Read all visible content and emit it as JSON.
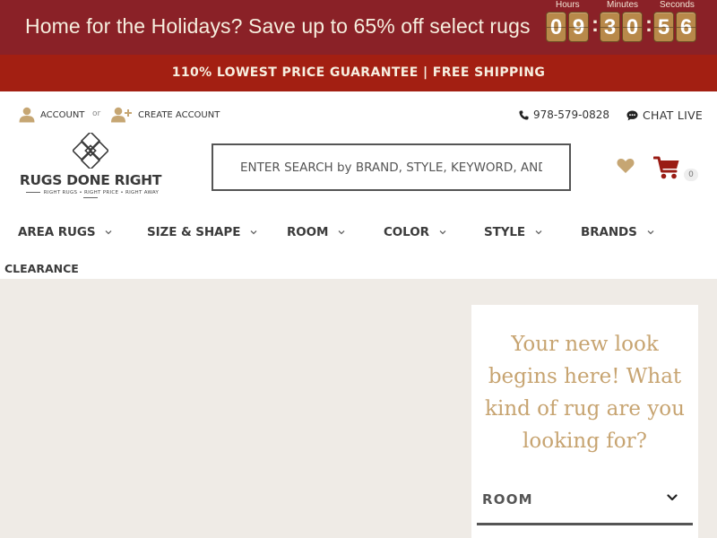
{
  "promo": {
    "text": "Home for the Holidays? Save up to 65% off select rugs",
    "countdown": {
      "hours_label": "Hours",
      "minutes_label": "Minutes",
      "seconds_label": "Seconds",
      "h1": "0",
      "h2": "9",
      "m1": "3",
      "m2": "0",
      "s1": "5",
      "s2": "6"
    }
  },
  "guarantee": {
    "text": "110% LOWEST PRICE GUARANTEE | FREE SHIPPING"
  },
  "account": {
    "account_label": "ACCOUNT",
    "or_label": "or",
    "create_label": "CREATE ACCOUNT"
  },
  "contact": {
    "phone": "978-579-0828",
    "chat": "CHAT LIVE"
  },
  "logo": {
    "name": "RUGS DONE RIGHT",
    "tagline": "RIGHT RUGS • RIGHT PRICE • RIGHT AWAY"
  },
  "search": {
    "placeholder": "ENTER SEARCH by BRAND, STYLE, KEYWORD, AND"
  },
  "cart": {
    "count": "0"
  },
  "nav": {
    "items": [
      {
        "label": "AREA RUGS"
      },
      {
        "label": "SIZE & SHAPE"
      },
      {
        "label": "ROOM"
      },
      {
        "label": "COLOR"
      },
      {
        "label": "STYLE"
      },
      {
        "label": "BRANDS"
      }
    ],
    "clearance": "CLEARANCE"
  },
  "finder": {
    "heading": "Your new look begins here! What kind of rug are you looking for?",
    "select_label": "ROOM"
  },
  "colors": {
    "promo_bg": "#8a2127",
    "guarantee_bg": "#a31f12",
    "accent_gold": "#c7a471",
    "page_bg": "#efebe6"
  }
}
